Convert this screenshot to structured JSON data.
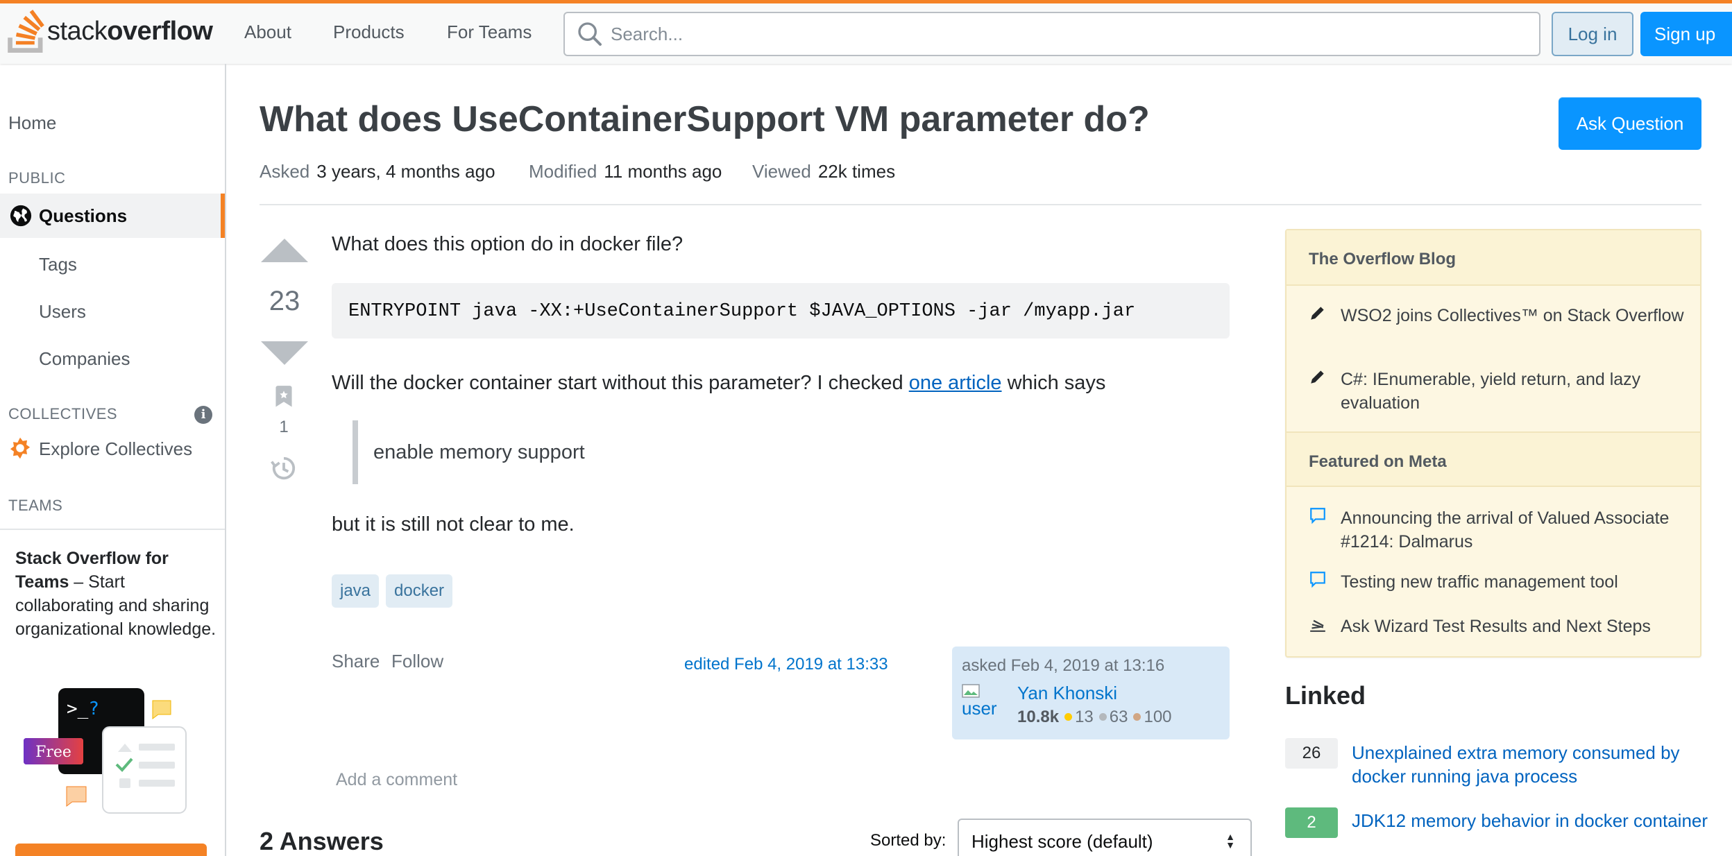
{
  "header": {
    "logo_text_light": "stack",
    "logo_text_bold": "overflow",
    "nav": [
      "About",
      "Products",
      "For Teams"
    ],
    "search_placeholder": "Search...",
    "login": "Log in",
    "signup": "Sign up"
  },
  "sidebar": {
    "home": "Home",
    "public_section": "PUBLIC",
    "questions": "Questions",
    "tags": "Tags",
    "users": "Users",
    "companies": "Companies",
    "collectives_section": "COLLECTIVES",
    "explore_collectives": "Explore Collectives",
    "teams_section": "TEAMS",
    "teams_title": "Stack Overflow for Teams",
    "teams_text": " – Start collaborating and sharing organizational knowledge.",
    "free_badge": "Free",
    "terminal_prompt": ">_?"
  },
  "question": {
    "title": "What does UseContainerSupport VM parameter do?",
    "ask_button": "Ask Question",
    "asked_label": "Asked",
    "asked_value": "3 years, 4 months ago",
    "modified_label": "Modified",
    "modified_value": "11 months ago",
    "viewed_label": "Viewed",
    "viewed_value": "22k times",
    "score": "23",
    "bookmark_count": "1",
    "body_intro": "What does this option do in docker file?",
    "code": "ENTRYPOINT java -XX:+UseContainerSupport $JAVA_OPTIONS -jar /myapp.jar",
    "body_p2_before": "Will the docker container start without this parameter? I checked ",
    "body_p2_link": "one article",
    "body_p2_after": " which says",
    "quote": "enable memory support",
    "body_p3": "but it is still not clear to me.",
    "tags": [
      "java",
      "docker"
    ],
    "share": "Share",
    "follow": "Follow",
    "edited": "edited Feb 4, 2019 at 13:33",
    "asked_card": "asked Feb 4, 2019 at 13:16",
    "avatar_alt": "user",
    "user_name": "Yan Khonski",
    "user_rep": "10.8k",
    "badges_gold": "13",
    "badges_silver": "63",
    "badges_bronze": "100",
    "add_comment": "Add a comment"
  },
  "answers": {
    "heading": "2 Answers",
    "sorted_label": "Sorted by:",
    "sort_value": "Highest score (default)"
  },
  "right": {
    "blog_heading": "The Overflow Blog",
    "blog_items": [
      "WSO2 joins Collectives™ on Stack Overflow",
      "C#: IEnumerable, yield return, and lazy evaluation"
    ],
    "meta_heading": "Featured on Meta",
    "meta_items": [
      "Announcing the arrival of Valued Associate #1214: Dalmarus",
      "Testing new traffic management tool",
      "Ask Wizard Test Results and Next Steps"
    ],
    "linked_heading": "Linked",
    "linked": [
      {
        "score": "26",
        "title": "Unexplained extra memory consumed by docker running java process"
      },
      {
        "score": "2",
        "title": "JDK12 memory behavior in docker container"
      }
    ]
  },
  "colors": {
    "brand_orange": "#f48225",
    "primary_blue": "#0a95ff",
    "link_blue": "#0063bf",
    "accepted_green": "#5eba7d",
    "blog_bg": "#fdf7e2"
  }
}
